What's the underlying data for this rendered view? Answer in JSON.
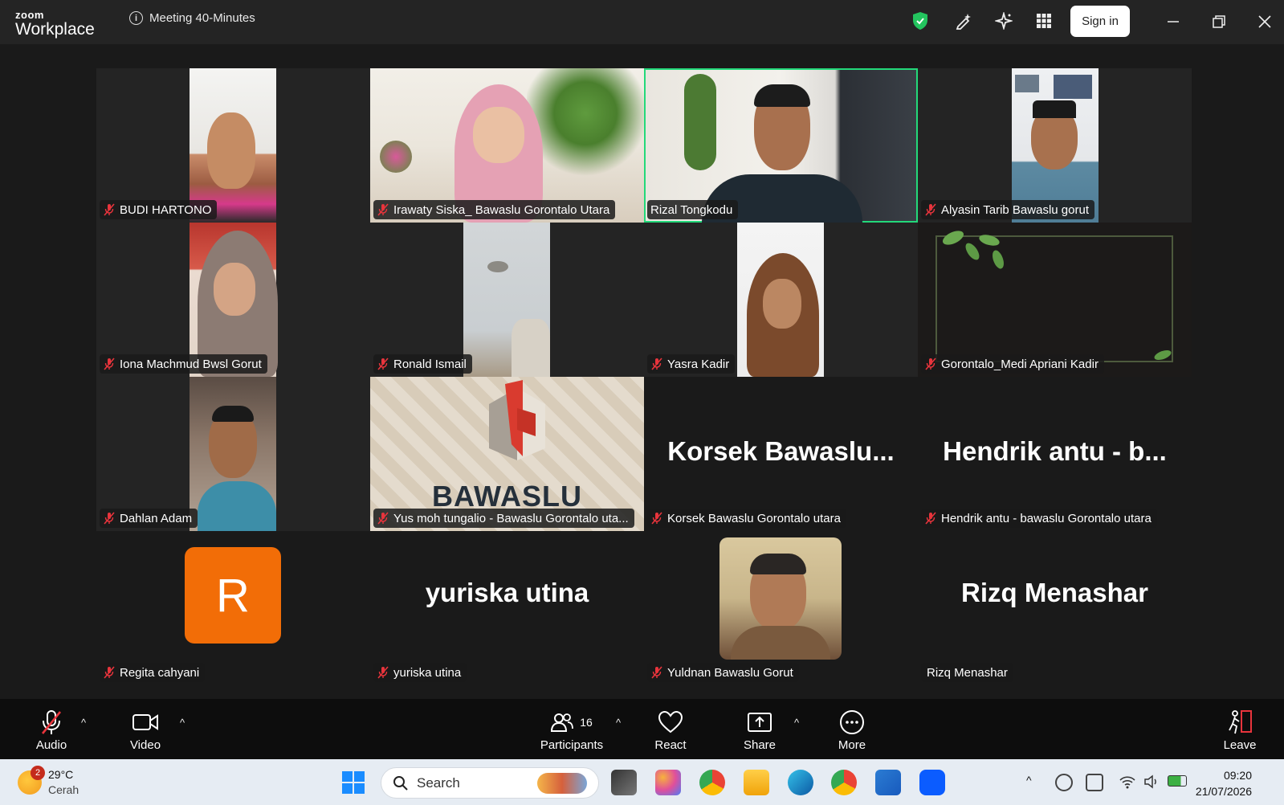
{
  "app": {
    "logo_top": "zoom",
    "logo_bottom": "Workplace",
    "meeting_title": "Meeting 40-Minutes",
    "sign_in_label": "Sign in"
  },
  "participants": [
    {
      "name": "BUDI HARTONO",
      "muted": true
    },
    {
      "name": "Irawaty Siska_ Bawaslu Gorontalo Utara",
      "muted": true
    },
    {
      "name": "Rizal Tongkodu",
      "muted": false,
      "active_speaker": true
    },
    {
      "name": "Alyasin Tarib  Bawaslu gorut",
      "muted": true
    },
    {
      "name": "Iona Machmud Bwsl Gorut",
      "muted": true
    },
    {
      "name": "Ronald Ismail",
      "muted": true
    },
    {
      "name": "Yasra Kadir",
      "muted": true
    },
    {
      "name": "Gorontalo_Medi Apriani Kadir",
      "muted": true
    },
    {
      "name": "Dahlan Adam",
      "muted": true
    },
    {
      "name": "Yus moh tungalio - Bawaslu Gorontalo uta...",
      "muted": true,
      "logo_text": "BAWASLU"
    },
    {
      "name": "Korsek Bawaslu Gorontalo utara",
      "muted": true,
      "big_label": "Korsek  Bawaslu..."
    },
    {
      "name": "Hendrik antu - bawaslu Gorontalo utara",
      "muted": true,
      "big_label": "Hendrik  antu  -  b..."
    },
    {
      "name": "Regita cahyani",
      "muted": true,
      "avatar_letter": "R"
    },
    {
      "name": "yuriska utina",
      "muted": true,
      "big_label": "yuriska utina"
    },
    {
      "name": "Yuldnan Bawaslu Gorut",
      "muted": true
    },
    {
      "name": "Rizq Menashar",
      "muted": false,
      "big_label": "Rizq Menashar"
    }
  ],
  "toolbar": {
    "audio": "Audio",
    "video": "Video",
    "participants": "Participants",
    "participants_count": "16",
    "react": "React",
    "share": "Share",
    "more": "More",
    "leave": "Leave"
  },
  "taskbar": {
    "weather_badge": "2",
    "temperature": "29°C",
    "condition": "Cerah",
    "search_placeholder": "Search",
    "time": "09:20",
    "date": "21/07/2026"
  },
  "colors": {
    "active_speaker_border": "#23d97a",
    "mute_red": "#e8343c",
    "avatar_orange": "#f26d07",
    "leave_red": "#e8343c"
  }
}
